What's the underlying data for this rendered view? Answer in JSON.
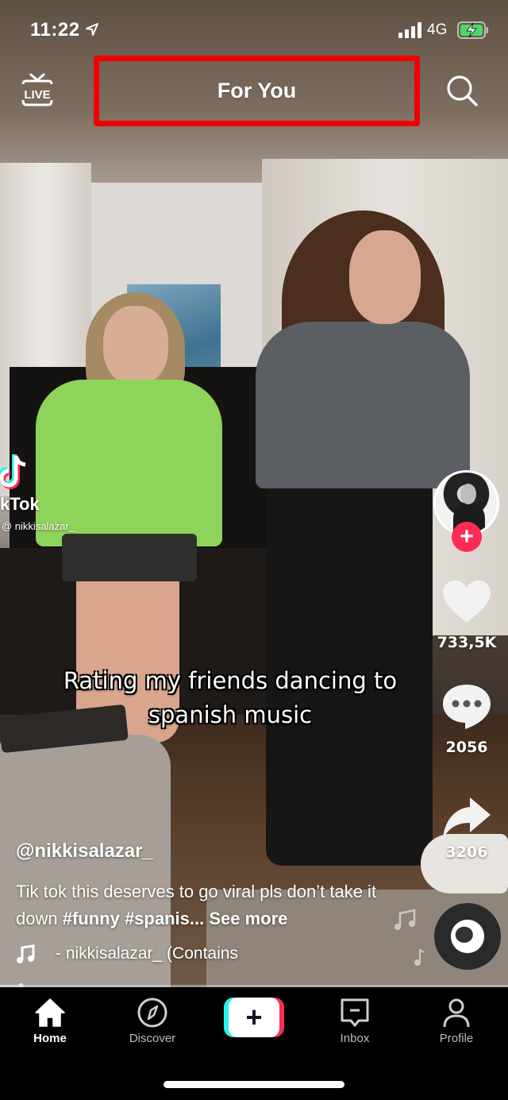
{
  "status_bar": {
    "time": "11:22",
    "network": "4G",
    "battery_state": "charging",
    "battery_color": "#4cd964"
  },
  "top_nav": {
    "live_label": "LIVE",
    "feed_title": "For You",
    "highlight_color": "#f00000",
    "search_icon": "search-icon"
  },
  "watermark": {
    "brand": "kTok",
    "user": "@ nikkisalazar_"
  },
  "video": {
    "caption_line1": "Rating my friends dancing to",
    "caption_line2": "spanish music",
    "progress_percent": 4
  },
  "actions": {
    "follow_label": "+",
    "like_count": "733,5K",
    "comment_count": "2056",
    "share_count": "3206",
    "accent_color": "#fe2c55"
  },
  "post": {
    "username": "@nikkisalazar_",
    "description_text": "Tik tok this deserves to go viral pls don’t take it down ",
    "hashtags": "#funny #spanis...",
    "see_more": "See more",
    "music": "- nikkisalazar_ (Contains"
  },
  "tabbar": {
    "items": [
      {
        "label": "Home",
        "icon": "home-icon",
        "active": true
      },
      {
        "label": "Discover",
        "icon": "compass-icon",
        "active": false
      },
      {
        "label": "",
        "icon": "plus-icon",
        "active": false
      },
      {
        "label": "Inbox",
        "icon": "inbox-icon",
        "active": false
      },
      {
        "label": "Profile",
        "icon": "person-icon",
        "active": false
      }
    ],
    "create_label": "+"
  }
}
